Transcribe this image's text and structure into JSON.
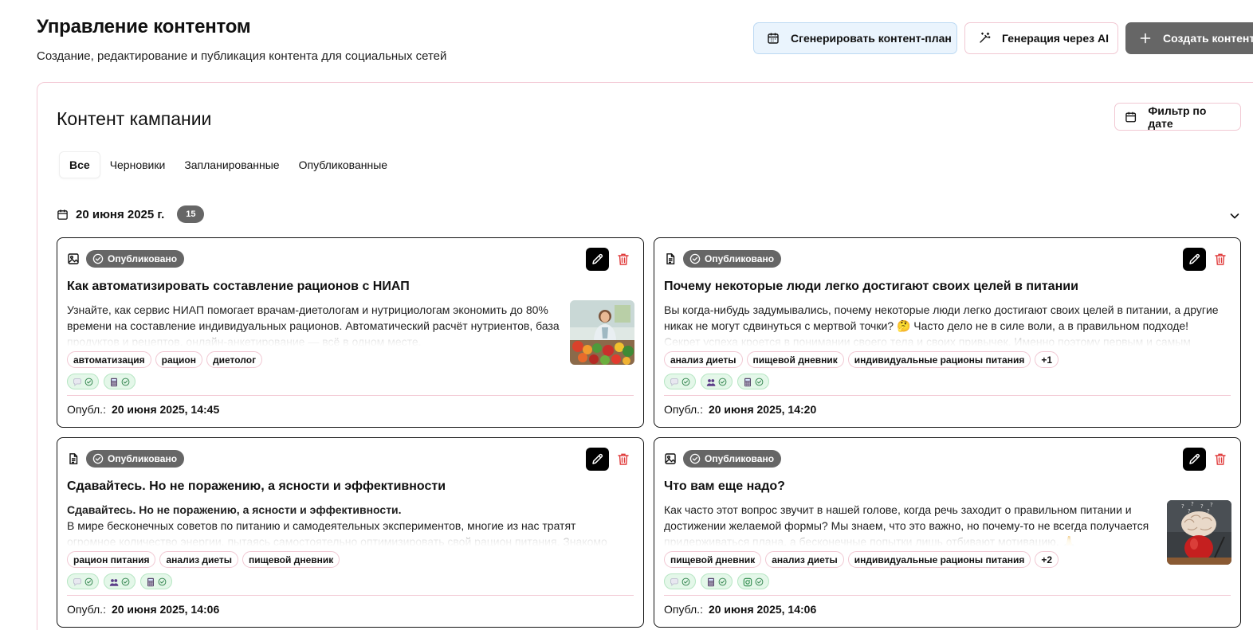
{
  "header": {
    "title": "Управление контентом",
    "subtitle": "Создание, редактирование и публикация контента для социальных сетей",
    "actions": {
      "generate_plan": "Сгенерировать контент-план",
      "ai_generation": "Генерация через AI",
      "create_content": "Создать контент"
    }
  },
  "panel": {
    "title": "Контент кампании",
    "date_filter": "Фильтр по дате",
    "tabs": [
      "Все",
      "Черновики",
      "Запланированные",
      "Опубликованные"
    ],
    "active_tab": "Все"
  },
  "group": {
    "date": "20 июня 2025 г.",
    "count": "15"
  },
  "colors": {
    "status_badge": "#666666",
    "platform_chip": "#e4f7e9",
    "tag_border": "#f1c8d3",
    "delete_icon": "#e03b3b",
    "plan_button_bg": "#eaf4fd"
  },
  "cards": [
    {
      "type_icon": "image-icon",
      "status": "Опубликовано",
      "title": "Как автоматизировать составление рационов с НИАП",
      "body_lead": "",
      "body": "Узнайте, как сервис НИАП помогает врачам-диетологам и нутрициологам экономить до 80% времени на составление индивидуальных рационов. Автоматический расчёт нутриентов, база продуктов и рецептов, онлайн-анкетирование — всё в одном месте.",
      "thumbnail": "nutritionist-vegetables-photo",
      "tags": [
        "автоматизация",
        "рацион",
        "диетолог"
      ],
      "extra_tags": "",
      "platforms": [
        "chat-icon",
        "calculator-icon"
      ],
      "footer_label": "Опубл.:",
      "footer_date": "20 июня 2025, 14:45"
    },
    {
      "type_icon": "document-icon",
      "status": "Опубликовано",
      "title": "Почему некоторые люди легко достигают своих целей в питании",
      "body_lead": "",
      "body": "Вы когда-нибудь задумывались, почему некоторые люди легко достигают своих целей в питании, а другие никак не могут сдвинуться с мертвой точки? 🤔 Часто дело не в силе воли, а в правильном подходе! Секрет успеха кроется в понимании своего тела и своих привычек. Именно поэтому первым и самым",
      "thumbnail": "",
      "tags": [
        "анализ диеты",
        "пищевой дневник",
        "индивидуальные рационы питания"
      ],
      "extra_tags": "+1",
      "platforms": [
        "chat-icon",
        "people-icon",
        "calculator-icon"
      ],
      "footer_label": "Опубл.:",
      "footer_date": "20 июня 2025, 14:20"
    },
    {
      "type_icon": "document-icon",
      "status": "Опубликовано",
      "title": "Сдавайтесь. Но не поражению, а ясности и эффективности",
      "body_lead": "Сдавайтесь. Но не поражению, а ясности и эффективности.",
      "body": "В мире бесконечных советов по питанию и самодеятельных экспериментов, многие из нас тратят огромное количество энергии, пытаясь самостоятельно оптимизировать свой рацион питания. Знакомо ощущение",
      "thumbnail": "",
      "tags": [
        "рацион питания",
        "анализ диеты",
        "пищевой дневник"
      ],
      "extra_tags": "",
      "platforms": [
        "chat-icon",
        "people-icon",
        "calculator-icon"
      ],
      "footer_label": "Опубл.:",
      "footer_date": "20 июня 2025, 14:06"
    },
    {
      "type_icon": "image-icon",
      "status": "Опубликовано",
      "title": "Что вам еще надо?",
      "body_lead": "",
      "body": "Как часто этот вопрос звучит в нашей голове, когда речь заходит о правильном питании и достижении желаемой формы? Мы знаем, что это важно, но почему-то не всегда получается придерживаться плана, а бесконечные попытки лишь отбивают мотивацию. 🙏",
      "thumbnail": "brain-apple-photo",
      "tags": [
        "пищевой дневник",
        "анализ диеты",
        "индивидуальные рационы питания"
      ],
      "extra_tags": "+2",
      "platforms": [
        "chat-icon",
        "calculator-icon",
        "camera-icon"
      ],
      "footer_label": "Опубл.:",
      "footer_date": "20 июня 2025, 14:06"
    }
  ]
}
